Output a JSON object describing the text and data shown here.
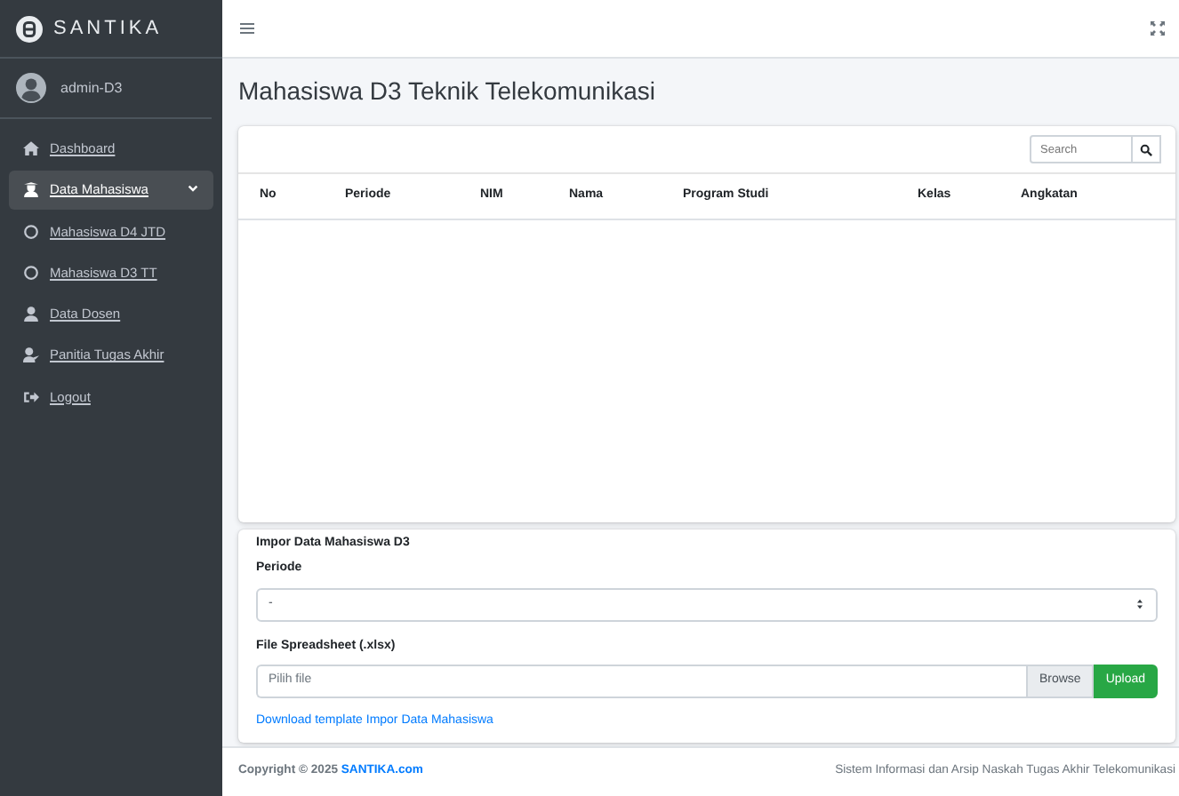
{
  "sidebar": {
    "brand": "SANTIKA",
    "user": "admin-D3",
    "items": [
      {
        "label": "Dashboard",
        "kind": "home",
        "selected": false
      },
      {
        "label": "Data Mahasiswa",
        "kind": "student",
        "selected": true,
        "expanded": true,
        "children": [
          {
            "label": "Mahasiswa D4 JTD",
            "kind": "circle",
            "selected": false
          },
          {
            "label": "Mahasiswa D3 TT",
            "kind": "circle",
            "selected": false
          }
        ]
      },
      {
        "label": "Data Dosen",
        "kind": "user",
        "selected": false
      },
      {
        "label": "Panitia Tugas Akhir",
        "kind": "team",
        "selected": false
      },
      {
        "label": "Logout",
        "kind": "logout",
        "selected": false
      }
    ]
  },
  "page_title": "Mahasiswa D3 Teknik Telekomunikasi",
  "table": {
    "search": {
      "placeholder": "Search"
    },
    "columns": [
      "No",
      "Periode",
      "NIM",
      "Nama",
      "Program Studi",
      "Kelas",
      "Angkatan"
    ]
  },
  "import": {
    "title": "Impor Data Mahasiswa D3",
    "period_label": "Periode",
    "period_value": "-",
    "file_label": "File Spreadsheet (.xlsx)",
    "file_placeholder": "Pilih file",
    "browse": "Browse",
    "upload": "Upload",
    "template_link": "Download template Impor Data Mahasiswa"
  },
  "footer": {
    "copyright": "Copyright © 2025",
    "link": "SANTIKA.com",
    "right": "Sistem Informasi dan Arsip Naskah Tugas Akhir Telekomunikasi"
  }
}
